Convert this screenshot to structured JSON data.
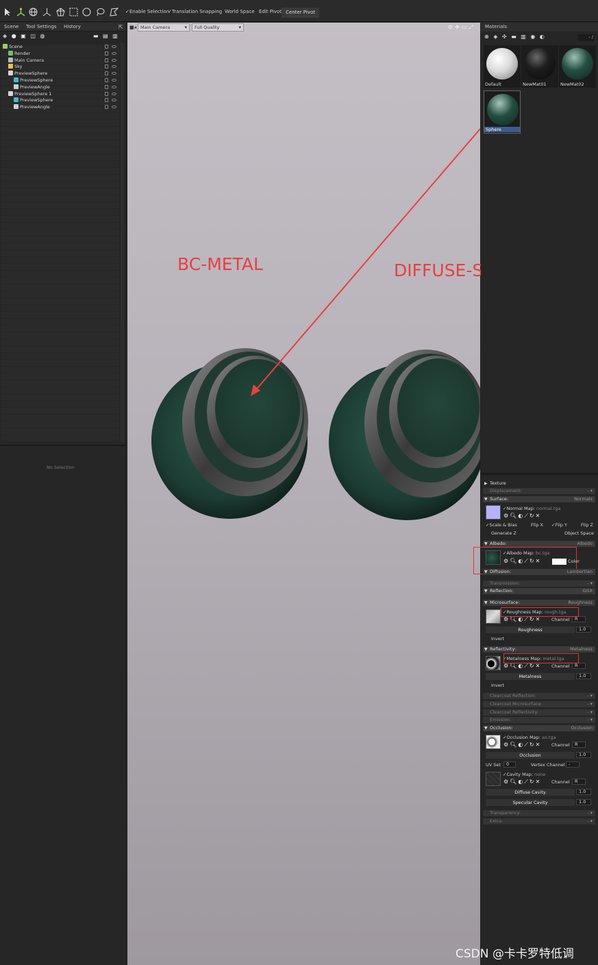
{
  "toolbar": {
    "enable_selection": "✓Enable Selection",
    "translation_snapping": "✓Translation Snapping",
    "world_space": "World Space",
    "edit_pivot": "Edit Pivot",
    "center_pivot": "Center Pivot"
  },
  "left_panel": {
    "tabs": [
      "Scene",
      "Tool Settings",
      "History"
    ],
    "tree": [
      {
        "label": "Scene",
        "indent": 0
      },
      {
        "label": "Render",
        "indent": 1
      },
      {
        "label": "Main Camera",
        "indent": 1
      },
      {
        "label": "Sky",
        "indent": 1
      },
      {
        "label": "PreviewSphere",
        "indent": 1
      },
      {
        "label": "PreviewSphere",
        "indent": 2
      },
      {
        "label": "PreviewAngle",
        "indent": 2
      },
      {
        "label": "PreviewSphere 1",
        "indent": 1
      },
      {
        "label": "PreviewSphere",
        "indent": 2
      },
      {
        "label": "PreviewAngle",
        "indent": 2
      }
    ],
    "no_selection": "No Selection"
  },
  "viewport": {
    "camera_select": "Main Camera",
    "quality_select": "Full Quality",
    "annotation_left": "BC-METAL",
    "annotation_right": "DIFFUSE-SPE"
  },
  "materials": {
    "title": "Materials",
    "count": "- /",
    "items": [
      "Default",
      "NewMat01",
      "NewMat02",
      "Sphere"
    ]
  },
  "inspector": {
    "texture": "Texture",
    "displacement": "Displacement:",
    "surface": "Surface:",
    "surface_value": "Normals",
    "normal_map": "✓Normal Map:",
    "normal_file": "normal.tga",
    "scale_bias": "✓Scale & Bias",
    "flip_x": "Flip X",
    "flip_y": "✓Flip Y",
    "flip_z": "Flip Z",
    "generate_z": "Generate Z",
    "object_space": "Object Space",
    "albedo": "Albedo:",
    "albedo_value": "Albedo",
    "albedo_map": "✓Albedo Map:",
    "albedo_file": "bc.tga",
    "color_label": "Color",
    "diffusion": "Diffusion:",
    "diffusion_value": "Lambertian",
    "transmission": "Transmission:",
    "reflection": "Reflection:",
    "reflection_value": "GGX",
    "microsurface": "Microsurface:",
    "microsurface_value": "Roughness",
    "roughness_map": "✓Roughness Map:",
    "roughness_file": "rough.tga",
    "channel": "Channel",
    "channel_r": "R",
    "roughness": "Roughness",
    "roughness_value": "1.0",
    "invert": "Invert",
    "reflectivity": "Reflectivity:",
    "reflectivity_value": "Metalness",
    "metalness_map": "✓Metalness Map:",
    "metalness_file": "metal.tga",
    "metalness": "Metalness",
    "metalness_value": "1.0",
    "clearcoat_reflection": "Clearcoat Reflection:",
    "clearcoat_microsurface": "Clearcoat Microsurface:",
    "clearcoat_reflectivity": "Clearcoat Reflectivity:",
    "emission": "Emission:",
    "occlusion": "Occlusion:",
    "occlusion_value": "Occlusion",
    "occlusion_map": "✓Occlusion Map:",
    "occlusion_file": "ao.tga",
    "occlusion_label": "Occlusion",
    "occlusion_amount": "1.0",
    "uv_set": "UV Set",
    "uv_value": "0",
    "vertex_channel": "Vertex Channel",
    "vertex_value": "-",
    "cavity_map": "✓Cavity Map:",
    "cavity_file": "none",
    "diffuse_cavity": "Diffuse Cavity",
    "diffuse_cavity_value": "1.0",
    "specular_cavity": "Specular Cavity",
    "specular_cavity_value": "1.0",
    "transparency": "Transparency:",
    "extra": "Extra:"
  },
  "watermark": "CSDN @卡卡罗特低调",
  "colors": {
    "annotation": "#e74040",
    "accent_select": "#3d5b8c"
  }
}
